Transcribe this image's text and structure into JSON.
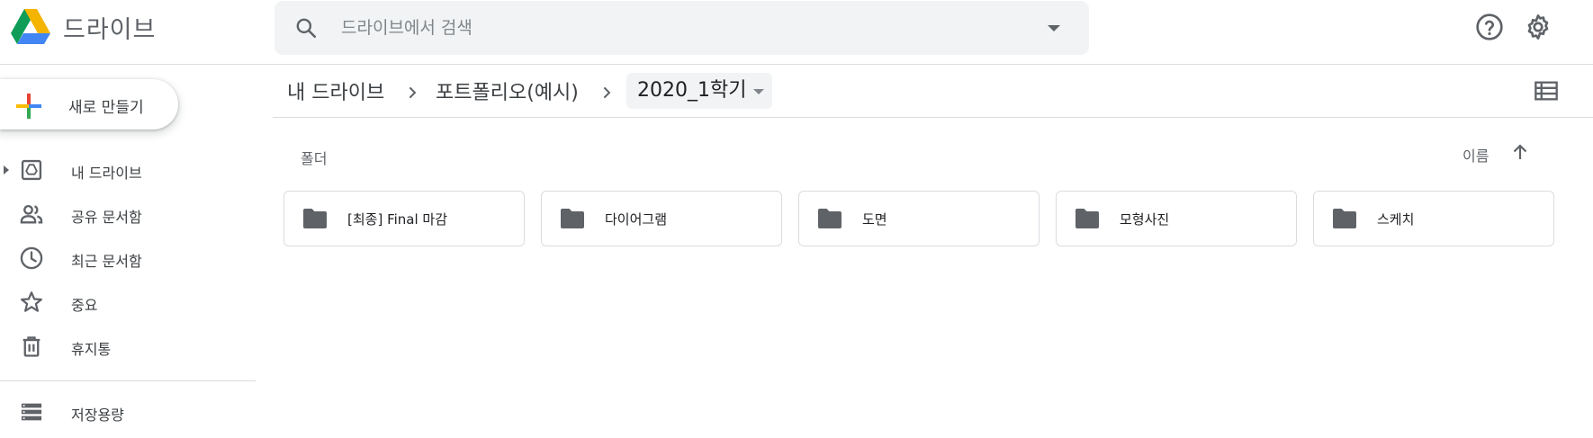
{
  "app": {
    "title": "드라이브",
    "accent_colors": {
      "green": "#0f9d58",
      "yellow": "#f4b400",
      "blue": "#4285f4",
      "red": "#db4437"
    }
  },
  "search": {
    "placeholder": "드라이브에서 검색",
    "icon": "search-icon",
    "options_icon": "caret-down-icon"
  },
  "header_actions": {
    "help": "help-icon",
    "settings": "gear-icon"
  },
  "sidebar": {
    "new_button": "새로 만들기",
    "items": [
      {
        "label": "내 드라이브",
        "icon": "my-drive-icon"
      },
      {
        "label": "공유 문서함",
        "icon": "shared-people-icon"
      },
      {
        "label": "최근 문서함",
        "icon": "clock-icon"
      },
      {
        "label": "중요",
        "icon": "star-icon"
      },
      {
        "label": "휴지통",
        "icon": "trash-icon"
      }
    ],
    "storage": {
      "label": "저장용량",
      "icon": "storage-icon"
    }
  },
  "breadcrumb": {
    "items": [
      "내 드라이브",
      "포트폴리오(예시)"
    ],
    "current": "2020_1학기"
  },
  "main": {
    "section_label": "폴더",
    "sort_label": "이름",
    "sort_direction": "ascending",
    "view_toggle_icon": "list-view-icon",
    "folders": [
      {
        "name": "[최종] Final 마감"
      },
      {
        "name": "다이어그램"
      },
      {
        "name": "도면"
      },
      {
        "name": "모형사진"
      },
      {
        "name": "스케치"
      }
    ]
  }
}
